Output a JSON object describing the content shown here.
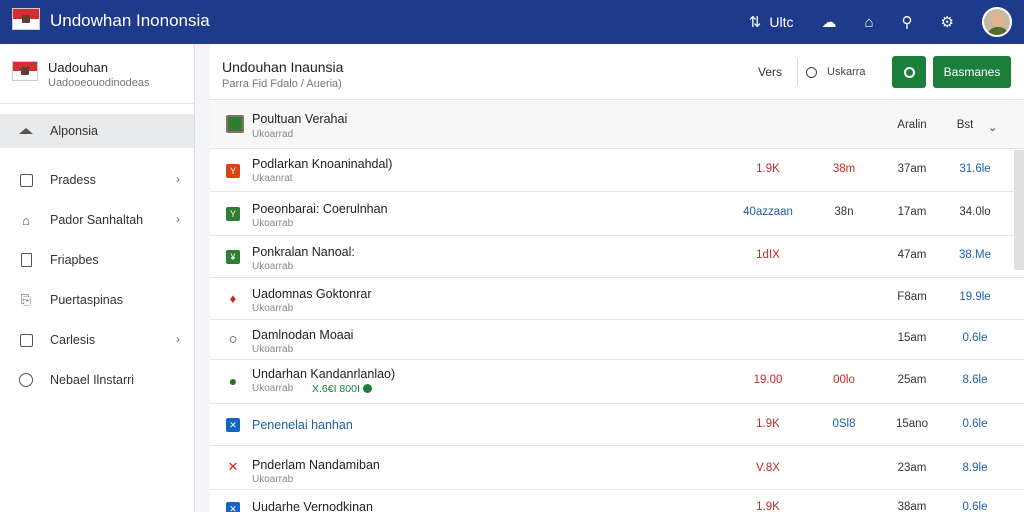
{
  "app": {
    "title": "Undowhan Inononsia"
  },
  "topbar": {
    "icons": [
      {
        "name": "filter-icon",
        "glyph": "⇅"
      },
      {
        "name": "text-label",
        "glyph": "Ultc"
      },
      {
        "name": "cloud-icon",
        "glyph": "☁"
      },
      {
        "name": "home-icon",
        "glyph": "⌂"
      },
      {
        "name": "search-icon",
        "glyph": "⚲"
      },
      {
        "name": "gear-icon",
        "glyph": "⚙"
      }
    ],
    "label_text": "Ultc"
  },
  "sidebar": {
    "org": "Uadouhan",
    "sub": "Uadooeouodinodeas",
    "items": [
      {
        "label": "Alponsia",
        "active": true,
        "chevron": false
      },
      {
        "label": "Pradess",
        "active": false,
        "chevron": true
      },
      {
        "label": "Pador Sanhaltah",
        "active": false,
        "chevron": true
      },
      {
        "label": "Friapbes",
        "active": false,
        "chevron": false
      },
      {
        "label": "Puertaspinas",
        "active": false,
        "chevron": false
      },
      {
        "label": "Carlesis",
        "active": false,
        "chevron": true
      },
      {
        "label": "Nebael Ilnstarri",
        "active": false,
        "chevron": false
      }
    ]
  },
  "main": {
    "title": "Undouhan Inaunsia",
    "subtitle": "Parra Fid Fdalo / Aueria)",
    "views_label": "Vers",
    "search_text": "Uskarra",
    "primary_button": "Basmanes"
  },
  "table": {
    "header": {
      "name": "Poultuan Verahai",
      "sub": "Ukoarrad",
      "col3": "Aralin",
      "col4": "Bst"
    },
    "rows": [
      {
        "name": "Podlarkan Knoaninahdal)",
        "sub": "Ukaanrat",
        "c1": "1.9K",
        "c2": "38m",
        "c3": "37am",
        "c4": "31.6le",
        "icon_color": "#d84315",
        "icon_glyph": "Y"
      },
      {
        "name": "Poeonbarai: Coerulnhan",
        "sub": "Ukoarrab",
        "c1": "40azzaan",
        "c2": "38n",
        "c3": "17am",
        "c4": "34.0lo",
        "c1_blue": true,
        "c2_dark": true,
        "icon_color": "#2e7d32",
        "icon_glyph": "Y"
      },
      {
        "name": "Ponkralan Nanoal:",
        "sub": "Ukoarrab",
        "c1": "1dIX",
        "c2": "",
        "c3": "47am",
        "c4": "38.Me",
        "icon_color": "#2e7d32",
        "icon_glyph": "¥"
      },
      {
        "name": "Uadomnas Goktonrar",
        "sub": "Ukoarrab",
        "c1": "",
        "c2": "",
        "c3": "F8am",
        "c4": "19.9le",
        "icon_color": "#c62828",
        "icon_glyph": "♦"
      },
      {
        "name": "Damlnodan Moaai",
        "sub": "Ukoarrab",
        "c1": "",
        "c2": "",
        "c3": "15am",
        "c4": "0.6le",
        "icon_color": "none",
        "icon_glyph": "○"
      },
      {
        "name": "Undarhan Kandanrlanlao)",
        "sub": "Ukoarrab",
        "extra": "X.6€I 800I",
        "c1": "19.00",
        "c2": "00lo",
        "c3": "25am",
        "c4": "8.6le",
        "icon_color": "#33691e",
        "icon_glyph": "●"
      },
      {
        "name": "Penenelai hanhan",
        "sub": "",
        "blue_name": true,
        "c1": "1.9K",
        "c2": "0Sl8",
        "c3": "15ano",
        "c4": "0.6le",
        "c2_blue": true,
        "icon_color": "#1565c0",
        "icon_glyph": "✕"
      },
      {
        "name": "Pnderlam Nandamiban",
        "sub": "Ukoarrab",
        "c1": "V.8X",
        "c2": "",
        "c3": "23am",
        "c4": "8.9le",
        "icon_color": "#c62828",
        "icon_glyph": "✕"
      },
      {
        "name": "Uudarhe Vernodkinan",
        "sub": "",
        "c1": "1.9K",
        "c2": "",
        "c3": "38am",
        "c4": "0.6le",
        "icon_color": "#1565c0",
        "icon_glyph": "✕"
      }
    ]
  }
}
